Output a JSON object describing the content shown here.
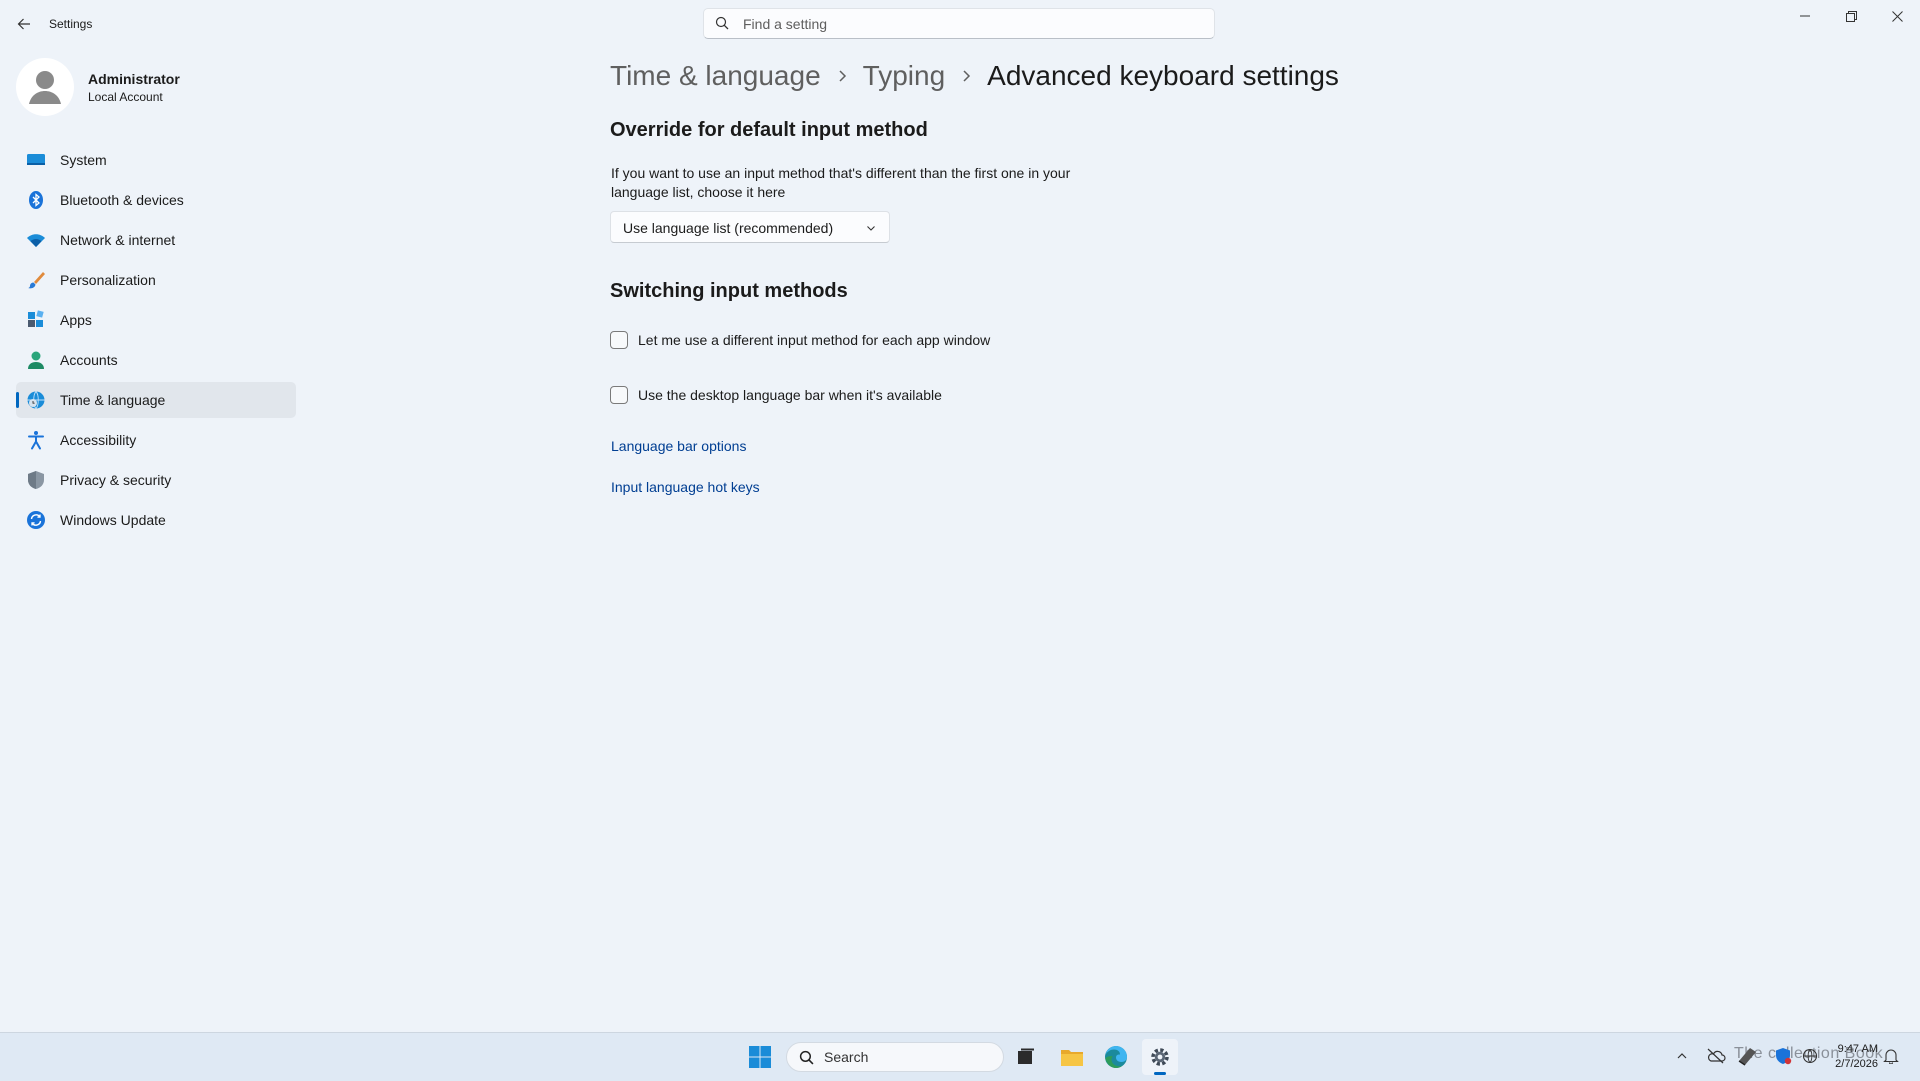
{
  "app": {
    "title": "Settings"
  },
  "search": {
    "placeholder": "Find a setting"
  },
  "profile": {
    "name": "Administrator",
    "account_type": "Local Account"
  },
  "sidebar": {
    "items": [
      {
        "label": "System",
        "icon": "system-icon"
      },
      {
        "label": "Bluetooth & devices",
        "icon": "bluetooth-icon"
      },
      {
        "label": "Network & internet",
        "icon": "wifi-icon"
      },
      {
        "label": "Personalization",
        "icon": "brush-icon"
      },
      {
        "label": "Apps",
        "icon": "apps-icon"
      },
      {
        "label": "Accounts",
        "icon": "accounts-icon"
      },
      {
        "label": "Time & language",
        "icon": "globe-clock-icon",
        "active": true
      },
      {
        "label": "Accessibility",
        "icon": "accessibility-icon"
      },
      {
        "label": "Privacy & security",
        "icon": "shield-icon"
      },
      {
        "label": "Windows Update",
        "icon": "update-icon"
      }
    ]
  },
  "breadcrumb": {
    "items": [
      "Time & language",
      "Typing"
    ],
    "current": "Advanced keyboard settings"
  },
  "override": {
    "title": "Override for default input method",
    "description": "If you want to use an input method that's different than the first one in your language list, choose it here",
    "dropdown_value": "Use language list (recommended)"
  },
  "switching": {
    "title": "Switching input methods",
    "option1": {
      "label": "Let me use a different input method for each app window",
      "checked": false
    },
    "option2": {
      "label": "Use the desktop language bar when it's available",
      "checked": false
    }
  },
  "links": {
    "language_bar_options": "Language bar options",
    "input_language_hot_keys": "Input language hot keys"
  },
  "taskbar": {
    "search_label": "Search",
    "time": "9:47 AM",
    "date": "2/7/2026",
    "watermark": "The collection Book"
  },
  "colors": {
    "accent": "#0067c0",
    "background": "#eef3f9",
    "link": "#003e92",
    "taskbar": "#dfe9f4"
  }
}
